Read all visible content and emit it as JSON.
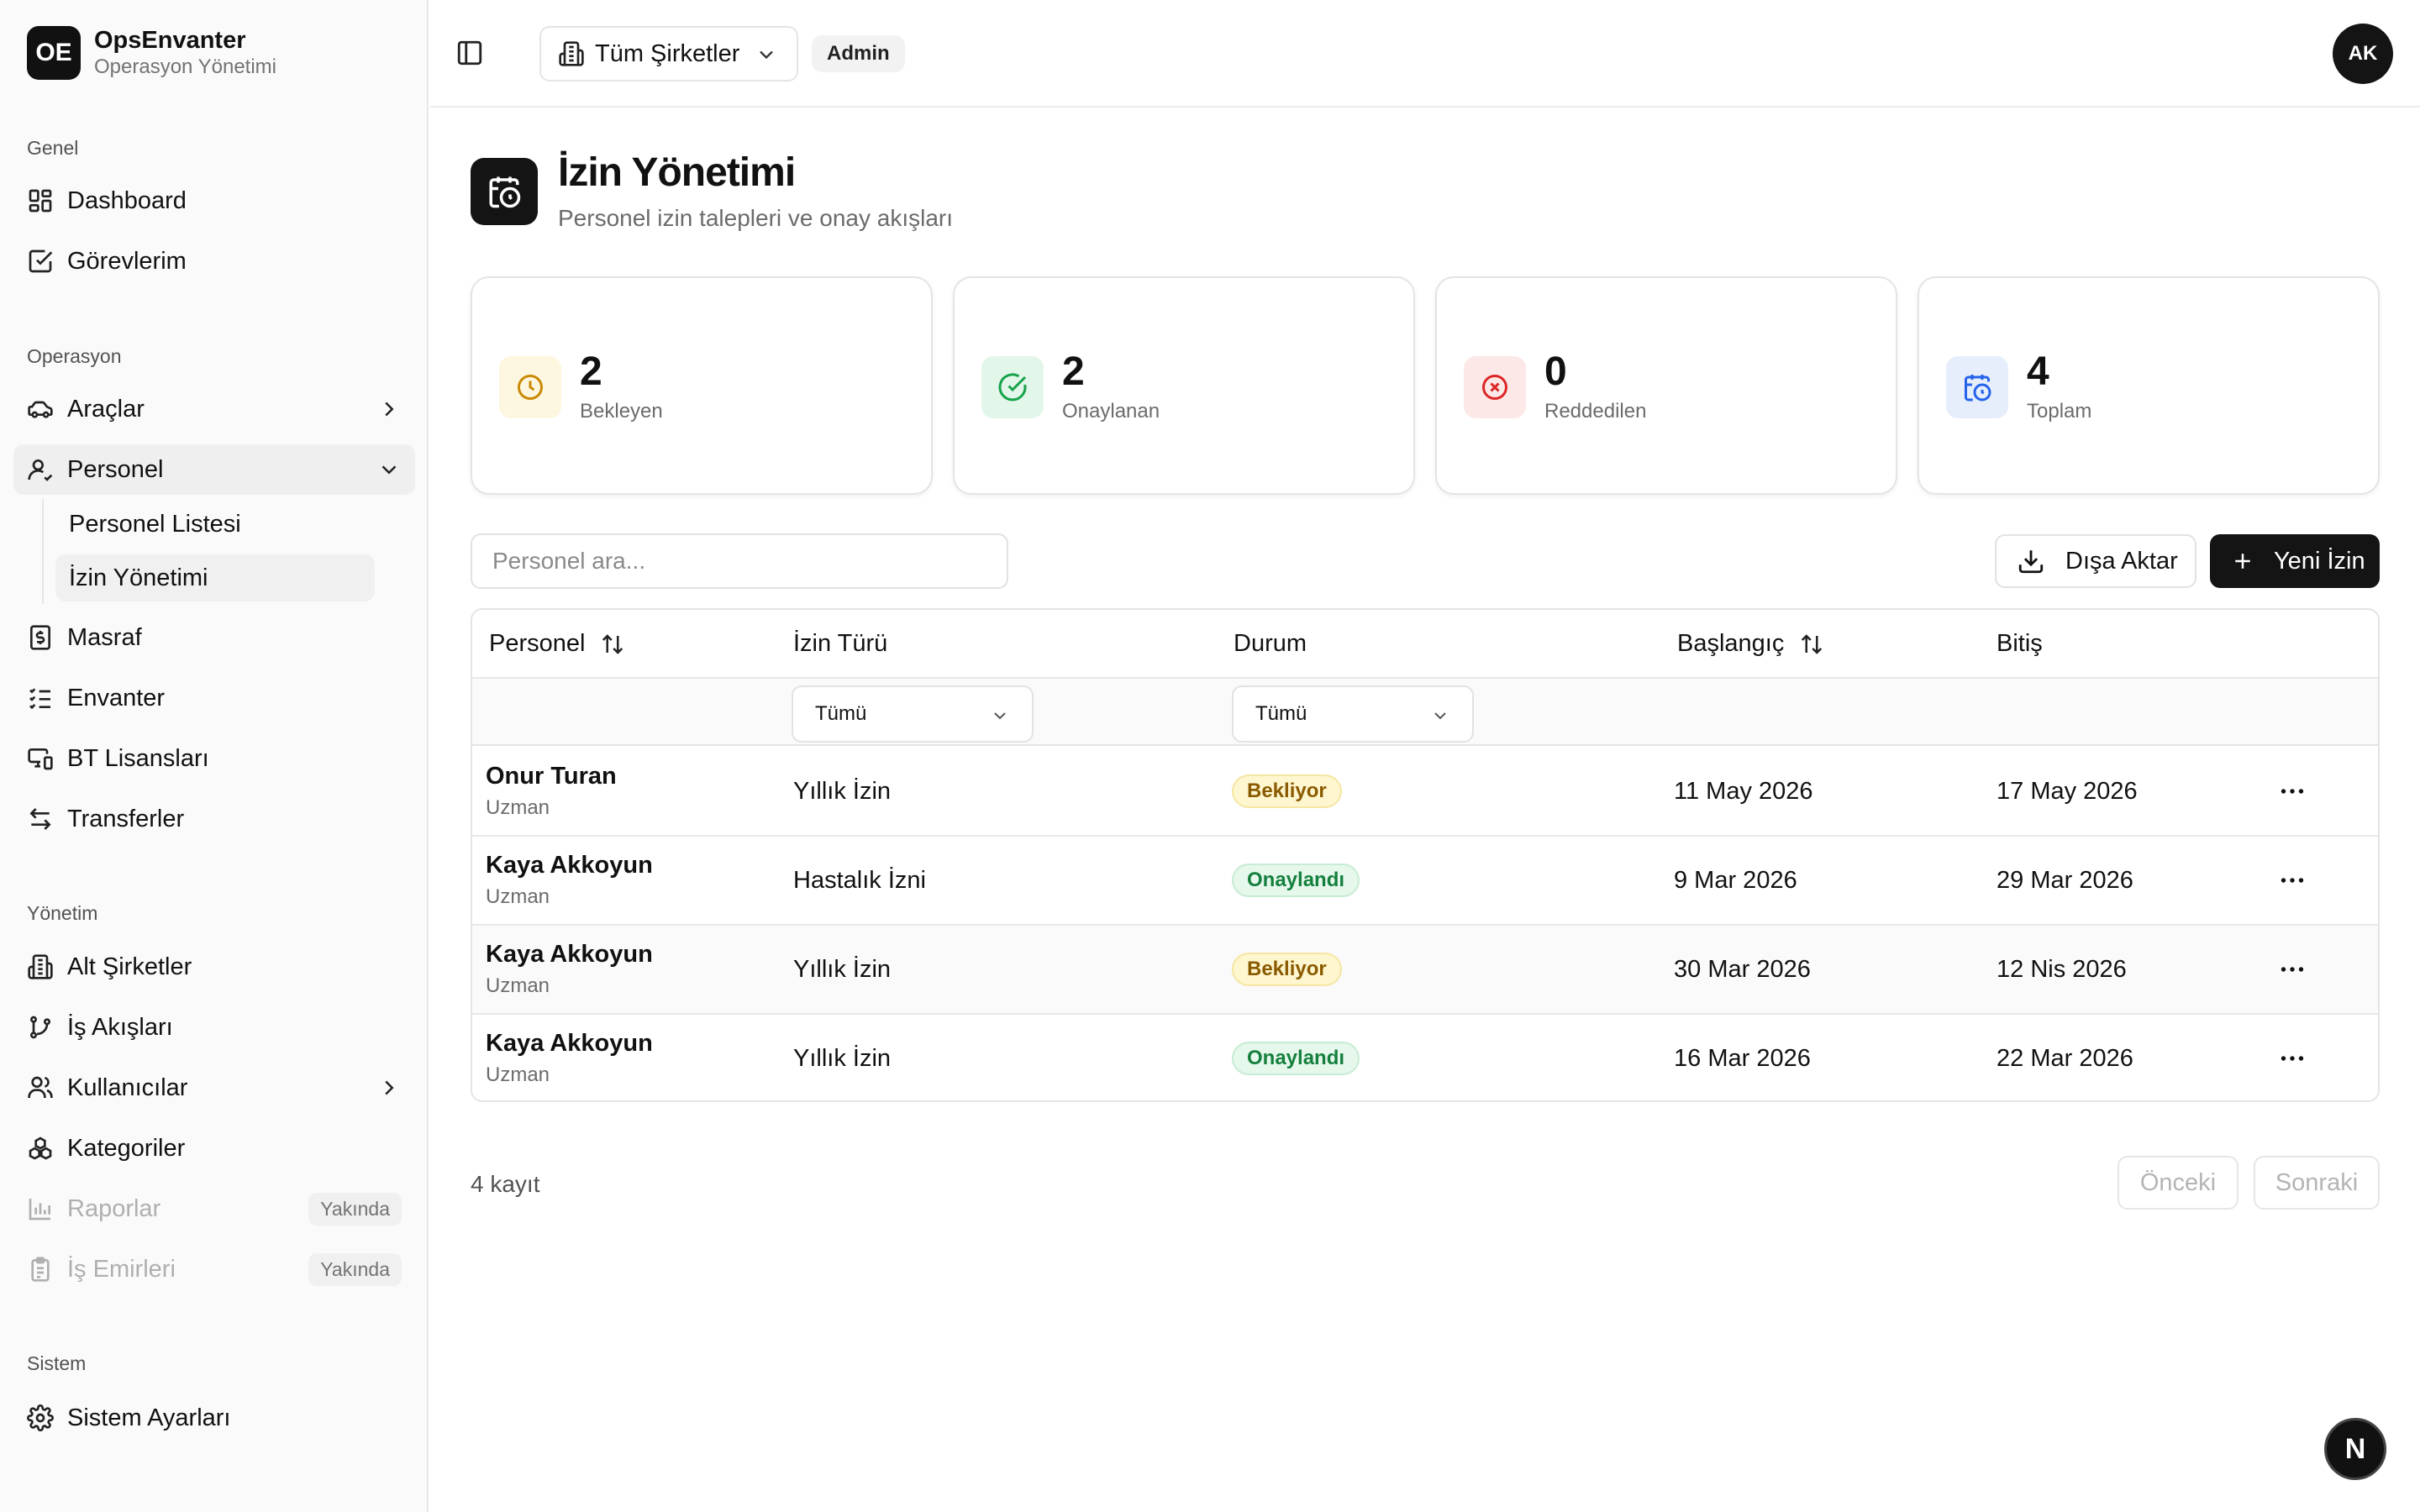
{
  "brand": {
    "logo": "OE",
    "name": "OpsEnvanter",
    "subtitle": "Operasyon Yönetimi"
  },
  "sidebar": {
    "groups": [
      {
        "label": "Genel"
      },
      {
        "label": "Operasyon"
      },
      {
        "label": "Yönetim"
      },
      {
        "label": "Sistem"
      }
    ],
    "items": {
      "dashboard": "Dashboard",
      "gorevlerim": "Görevlerim",
      "araclar": "Araçlar",
      "personel": "Personel",
      "personel_listesi": "Personel Listesi",
      "izin_yonetimi": "İzin Yönetimi",
      "masraf": "Masraf",
      "envanter": "Envanter",
      "bt_lisanslari": "BT Lisansları",
      "transferler": "Transferler",
      "alt_sirketler": "Alt Şirketler",
      "is_akislari": "İş Akışları",
      "kullanicilar": "Kullanıcılar",
      "kategoriler": "Kategoriler",
      "raporlar": "Raporlar",
      "is_emirleri": "İş Emirleri",
      "sistem_ayarlari": "Sistem Ayarları"
    },
    "soon_label": "Yakında"
  },
  "header": {
    "company_select": "Tüm Şirketler",
    "role": "Admin",
    "avatar": "AK"
  },
  "page": {
    "title": "İzin Yönetimi",
    "subtitle": "Personel izin talepleri ve onay akışları"
  },
  "stats": [
    {
      "value": "2",
      "label": "Bekleyen",
      "color": "#ca8a04",
      "bg": "#fef7e0"
    },
    {
      "value": "2",
      "label": "Onaylanan",
      "color": "#16a34a",
      "bg": "#e3f6ea"
    },
    {
      "value": "0",
      "label": "Reddedilen",
      "color": "#dc2626",
      "bg": "#fde8e8"
    },
    {
      "value": "4",
      "label": "Toplam",
      "color": "#2563eb",
      "bg": "#e6eefc"
    }
  ],
  "toolbar": {
    "search_placeholder": "Personel ara...",
    "export_label": "Dışa Aktar",
    "new_label": "Yeni İzin"
  },
  "table": {
    "headers": [
      "Personel",
      "İzin Türü",
      "Durum",
      "Başlangıç",
      "Bitiş"
    ],
    "filters": {
      "izin_turu": "Tümü",
      "durum": "Tümü"
    },
    "rows": [
      {
        "name": "Onur Turan",
        "role": "Uzman",
        "type": "Yıllık İzin",
        "status": "Bekliyor",
        "start": "11 May 2026",
        "end": "17 May 2026"
      },
      {
        "name": "Kaya Akkoyun",
        "role": "Uzman",
        "type": "Hastalık İzni",
        "status": "Onaylandı",
        "start": "9 Mar 2026",
        "end": "29 Mar 2026"
      },
      {
        "name": "Kaya Akkoyun",
        "role": "Uzman",
        "type": "Yıllık İzin",
        "status": "Bekliyor",
        "start": "30 Mar 2026",
        "end": "12 Nis 2026"
      },
      {
        "name": "Kaya Akkoyun",
        "role": "Uzman",
        "type": "Yıllık İzin",
        "status": "Onaylandı",
        "start": "16 Mar 2026",
        "end": "22 Mar 2026"
      }
    ]
  },
  "footer": {
    "record_count": "4 kayıt",
    "prev_label": "Önceki",
    "next_label": "Sonraki"
  },
  "dev_badge": "N"
}
